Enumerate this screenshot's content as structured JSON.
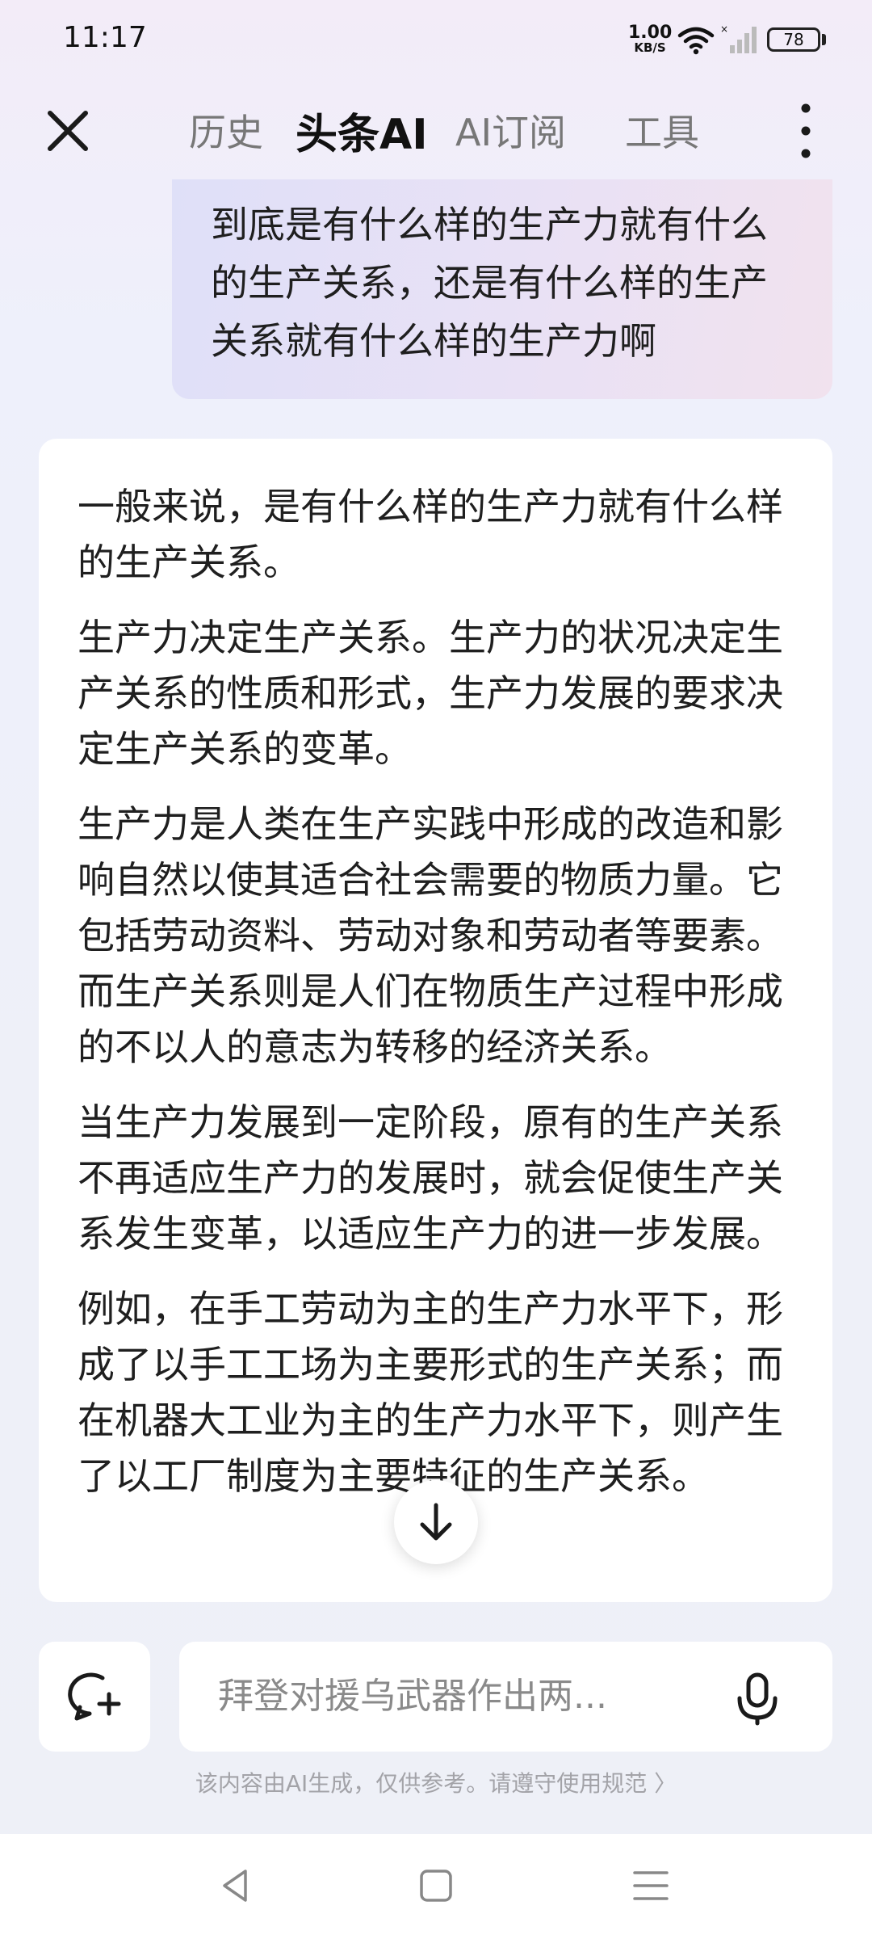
{
  "status_bar": {
    "time": "11:17",
    "network_speed_value": "1.00",
    "network_speed_unit": "KB/S",
    "battery": "78"
  },
  "top_nav": {
    "tabs": [
      {
        "label": "历史",
        "active": false
      },
      {
        "label": "头条AI",
        "active": true
      },
      {
        "label": "AI订阅",
        "active": false
      },
      {
        "label": "工具",
        "active": false
      }
    ]
  },
  "conversation": {
    "user_message": "到底是有什么样的生产力就有什么的生产关系，还是有什么样的生产关系就有什么样的生产力啊",
    "ai_paragraphs": [
      "一般来说，是有什么样的生产力就有什么样的生产关系。",
      "生产力决定生产关系。生产力的状况决定生产关系的性质和形式，生产力发展的要求决定生产关系的变革。",
      "生产力是人类在生产实践中形成的改造和影响自然以使其适合社会需要的物质力量。它包括劳动资料、劳动对象和劳动者等要素。而生产关系则是人们在物质生产过程中形成的不以人的意志为转移的经济关系。",
      "当生产力发展到一定阶段，原有的生产关系不再适应生产力的发展时，就会促使生产关系发生变革，以适应生产力的进一步发展。",
      "例如，在手工劳动为主的生产力水平下，形成了以手工工场为主要形式的生产关系；而在机器大工业为主的生产力水平下，则产生了以工厂制度为主要特征的生产关系。"
    ]
  },
  "input": {
    "placeholder": "拜登对援乌武器作出两..."
  },
  "disclaimer": "该内容由AI生成，仅供参考。请遵守使用规范 〉",
  "icons": {
    "close": "close-icon",
    "more": "more-vertical-icon",
    "scroll_down": "arrow-down-icon",
    "new_chat": "chat-plus-icon",
    "mic": "microphone-icon",
    "nav_back": "triangle-back-icon",
    "nav_home": "square-home-icon",
    "nav_menu": "menu-lines-icon"
  },
  "colors": {
    "accent_text": "#111111",
    "inactive_tab": "#777777",
    "placeholder": "#8a8a8a"
  }
}
